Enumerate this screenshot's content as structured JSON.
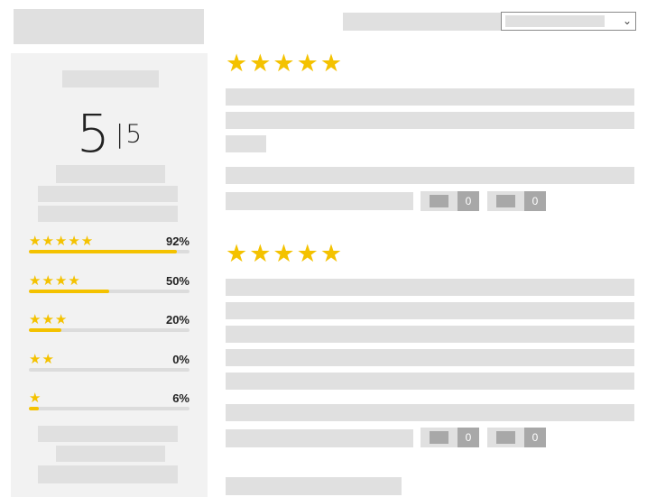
{
  "summary": {
    "average": "5",
    "separator": "|",
    "max": "5",
    "distribution": [
      {
        "stars": 5,
        "label": "★★★★★",
        "percent_label": "92%",
        "percent": 92
      },
      {
        "stars": 4,
        "label": "★★★★",
        "percent_label": "50%",
        "percent": 50
      },
      {
        "stars": 3,
        "label": "★★★",
        "percent_label": "20%",
        "percent": 20
      },
      {
        "stars": 2,
        "label": "★★",
        "percent_label": "0%",
        "percent": 0
      },
      {
        "stars": 1,
        "label": "★",
        "percent_label": "6%",
        "percent": 6
      }
    ]
  },
  "reviews": [
    {
      "rating": 5,
      "stars": "★★★★★",
      "helpful_count": "0",
      "unhelpful_count": "0"
    },
    {
      "rating": 5,
      "stars": "★★★★★",
      "helpful_count": "0",
      "unhelpful_count": "0"
    }
  ],
  "icons": {
    "sort": "chevron-down-icon",
    "star": "star-icon",
    "vote_up": "thumbs-up-icon",
    "vote_down": "thumbs-down-icon"
  },
  "colors": {
    "star": "#f4c200",
    "placeholder": "#e0e0e0",
    "vote_count_bg": "#a8a8a8",
    "sidebar_bg": "#f2f2f2"
  }
}
